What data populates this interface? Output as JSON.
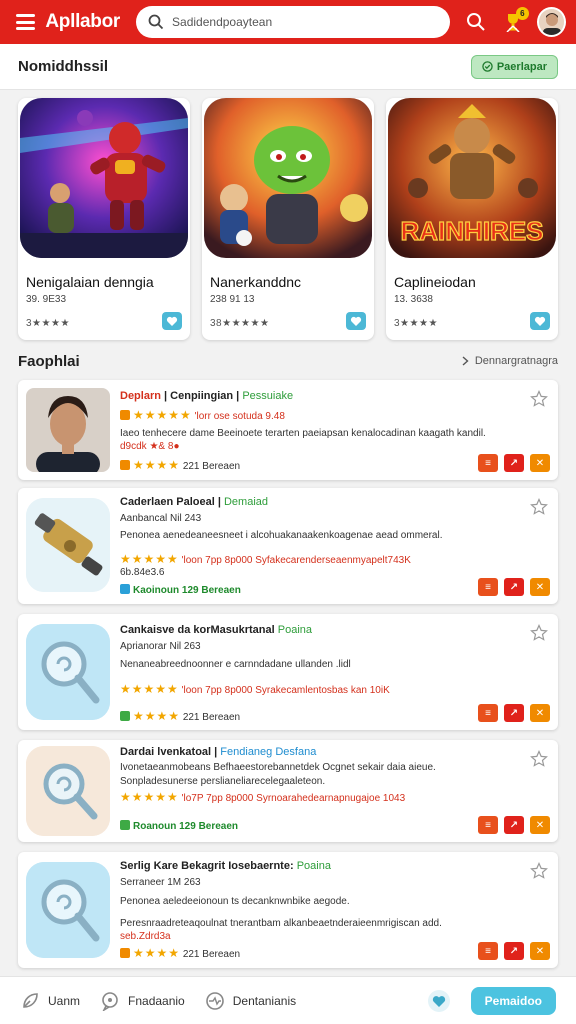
{
  "header": {
    "app_name": "Apllabor",
    "search_placeholder": "Sadidendpoaytean",
    "notif_count": "6",
    "colors": {
      "header_bg": "#e0221b",
      "accent": "#4cc3e0"
    }
  },
  "section1": {
    "title": "Nomiddhssil",
    "button_label": "Paerlapar"
  },
  "featured": [
    {
      "name": "Nenigalaian denngia",
      "meta": "39. 9E33",
      "stars": "3★★★★",
      "rating": 1,
      "icon": "hero-art"
    },
    {
      "name": "Nanerkanddnc",
      "meta": "238 91 13",
      "stars": "38★★★★★",
      "rating": 4,
      "icon": "alien-art"
    },
    {
      "name": "Caplineiodan",
      "meta": "13. 3638",
      "stars": "3★★★★",
      "rating": 3,
      "logo_text": "RAINHIRES",
      "icon": "warrior-art"
    }
  ],
  "section2": {
    "title": "Faophlai",
    "link_label": "Dennargratnagra"
  },
  "items": [
    {
      "title": "Deplarn",
      "title2": "Cenpiingian",
      "tag": "Pessuiake",
      "line2": "'lorr ose sotuda  9.48",
      "line3": "Iaeo tenhecere dame  Beeinoete terarten paeiapsan kenalocadinan kaagath kandil.",
      "line3b": "d9cdk ★& 8●",
      "line4": "221  Bereaen",
      "icon": "person-photo"
    },
    {
      "title": "Caderlaen Paloeal",
      "tag": "Demaiad",
      "line2": "Aanbancal  Nil 243",
      "line3": "Penonea aenedeaneesneet  i  alcohuakanaakenkoagenae aead ommeral.",
      "line4": "'loon 7pp 8p000   Syfakecarenderseaenmyapelt743K",
      "line4b": "6b.84e3.6",
      "line5": "Kaoinoun  129  Bereaen",
      "icon": "wrench-icon"
    },
    {
      "title": "Cankaisve da korMasukrtanal",
      "tag": "Poaina",
      "line2": "Aprianorar  Nil 263",
      "line3": "Nenaneabreednoonner e carnndadane ullanden .lidl",
      "line4": "'loon 7pp 8p000   Syrakecamlentosbas kan          10iK",
      "line5": "221  Bereaen",
      "icon": "magnifier-icon"
    },
    {
      "title": "Dardai lvenkatoal",
      "tag": "Fendianeg  Desfana",
      "line2": "Ivonetaeanmobeans  Befhaeestorebannetdek Ocgnet sekair daia aieue.",
      "line3": "Sonpladesunerse perslianeliarecelegaaleteon.",
      "line4": "'lo7P 7pp 8p000   Syrnoarahedearnapnugajoe  1043",
      "line5": "Roanoun  129  Bereaen",
      "icon": "magnifier-icon"
    },
    {
      "title": "Serlig Kare Bekagrit",
      "title2": "Iosebaernte:",
      "tag": "Poaina",
      "line2": "Serraneer  1M 263",
      "line3": "Penonea aeledeeionoun  ts decanknwnbike aegode.",
      "line4": "Peresnraadreteaqoulnat tnerantbam alkanbeaetnderaieenmrigiscan add.",
      "line4b": "seb.Zdrd3a",
      "line5": "221  Bereaen",
      "icon": "magnifier-icon"
    }
  ],
  "bottom_nav": {
    "items": [
      "Uanm",
      "Fnadaanio",
      "Dentanianis"
    ],
    "button_label": "Pemaidoo"
  }
}
